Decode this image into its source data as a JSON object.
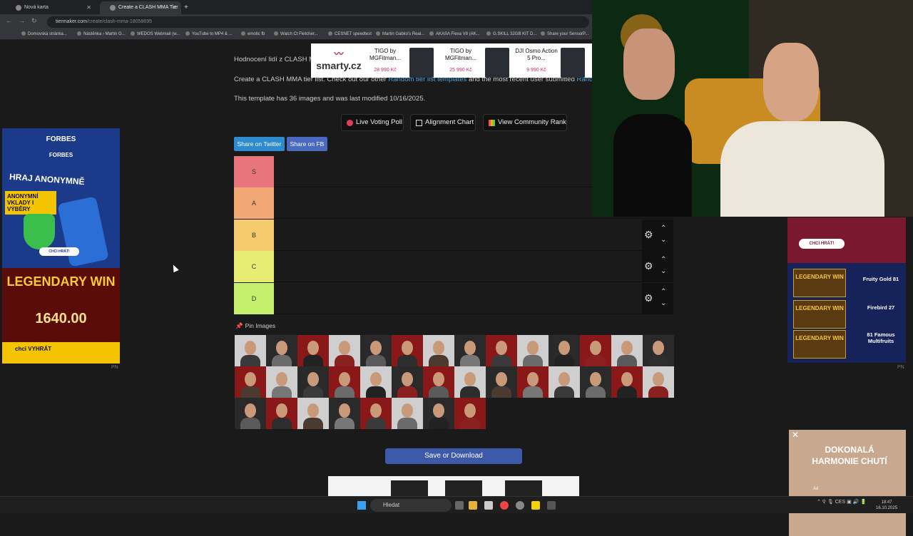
{
  "tabs": [
    {
      "label": "Nová karta"
    },
    {
      "label": "Create a CLASH MMA Tier List"
    }
  ],
  "url": {
    "host": "tiermaker.com",
    "path": "/create/clash-mma-18058695"
  },
  "bookmarks": [
    "Domovská stránka...",
    "Nástěnka › Martin G...",
    "WEDOS Webmail (w...",
    "YouTube to MP4 & ...",
    "emotic fb",
    "Watch Ct Fletcher...",
    "CESNET speedtest",
    "Martin Gabko's Real...",
    "AKASA Flexa V8 (AK...",
    "G.SKILL 32GB KIT D...",
    "Share your SensorP..."
  ],
  "page": {
    "rating_text": "Hodnocení lidí z CLASH M",
    "intro_a": "Create a CLASH MMA tier list. Check out our other",
    "intro_link1": "Random tier list templates",
    "intro_b": "and the most recent user submitted",
    "intro_link2": "Rando",
    "template_info": "This template has 36 images and was last modified 10/16/2025.",
    "btn_live_voting": "Live Voting Poll",
    "btn_alignment": "Alignment Chart",
    "btn_community": "View Community Rank",
    "share_twitter": "Share on Twitter",
    "share_fb": "Share on FB",
    "pin_images": "Pin Images",
    "save_download": "Save or Download"
  },
  "tiers": [
    {
      "label": "S",
      "color": "#e8747c"
    },
    {
      "label": "A",
      "color": "#f0a773"
    },
    {
      "label": "B",
      "color": "#f5c96e"
    },
    {
      "label": "C",
      "color": "#e6ed73"
    },
    {
      "label": "D",
      "color": "#c5f06e"
    }
  ],
  "ads": {
    "left": {
      "brand": "FORBES",
      "brand2": "FORBES",
      "headline": "HRAJ ANONYMNĚ",
      "sub": "ANONYMNÍ VKLADY I VÝBĚRY",
      "cta_small": "CHCI HRÁT!",
      "game": "LEGENDARY WIN",
      "amount": "1640.00",
      "cta": "chci VYHRÁT",
      "pn": "PN"
    },
    "top": {
      "logo": "smarty.cz",
      "p1_name": "TIGO by MGFitman...",
      "p1_price": "28 990 Kč",
      "p2_name": "TIGO by MGFitman...",
      "p2_price": "25 990 Kč",
      "p3_name": "DJI Osmo Action 5 Pro...",
      "p3_price": "9 990 Kč"
    },
    "right": {
      "cta": "CHCI HRÁT!",
      "g1": "Fruity Gold 81",
      "g2": "Firebird 27",
      "g3": "81 Famous Multifruits",
      "pn": "PN"
    },
    "corner": {
      "text": "DOKONALÁ HARMONIE CHUTÍ",
      "ad": "Ad"
    }
  },
  "taskbar": {
    "search": "Hledat",
    "time": "18:47",
    "date": "16.10.2025",
    "lang": "CES"
  }
}
